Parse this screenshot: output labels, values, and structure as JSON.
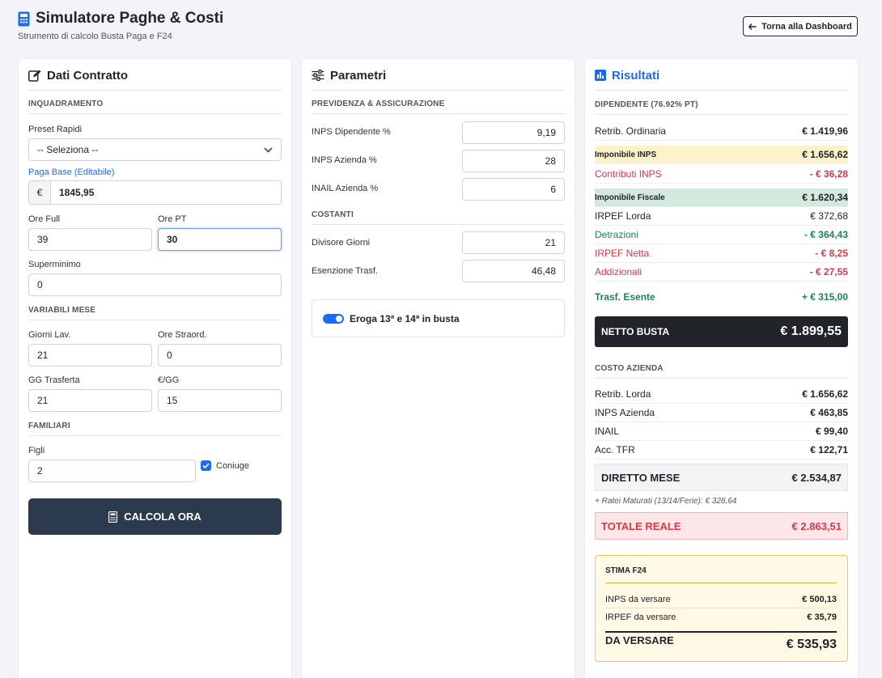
{
  "header": {
    "title": "Simulatore Paghe & Costi",
    "subtitle": "Strumento di calcolo Busta Paga e F24",
    "back_label": "Torna alla Dashboard"
  },
  "contratto": {
    "title": "Dati Contratto",
    "section_inquadramento": "INQUADRAMENTO",
    "preset_label": "Preset Rapidi",
    "preset_value": "-- Seleziona --",
    "paga_base_label": "Paga Base (Editabile)",
    "currency": "€",
    "paga_base_value": "1845,95",
    "ore_full_label": "Ore Full",
    "ore_full_value": "39",
    "ore_pt_label": "Ore PT",
    "ore_pt_value": "30",
    "superminimo_label": "Superminimo",
    "superminimo_value": "0",
    "section_variabili": "VARIABILI MESE",
    "giorni_lav_label": "Giorni Lav.",
    "giorni_lav_value": "21",
    "ore_straord_label": "Ore Straord.",
    "ore_straord_value": "0",
    "gg_trasferta_label": "GG Trasferta",
    "gg_trasferta_value": "21",
    "euro_gg_label": "€/GG",
    "euro_gg_value": "15",
    "section_familiari": "FAMILIARI",
    "figli_label": "Figli",
    "figli_value": "2",
    "coniuge_label": "Coniuge",
    "coniuge_checked": true,
    "calc_button": "CALCOLA ORA"
  },
  "parametri": {
    "title": "Parametri",
    "section_previdenza": "PREVIDENZA & ASSICURAZIONE",
    "inps_dip_label": "INPS Dipendente %",
    "inps_dip_value": "9,19",
    "inps_az_label": "INPS Azienda %",
    "inps_az_value": "28",
    "inail_label": "INAIL Azienda %",
    "inail_value": "6",
    "section_costanti": "COSTANTI",
    "divisore_label": "Divisore Giorni",
    "divisore_value": "21",
    "esenzione_label": "Esenzione Trasf.",
    "esenzione_value": "46,48",
    "toggle_label": "Eroga 13ª e 14ª in busta",
    "toggle_on": true
  },
  "risultati": {
    "title": "Risultati",
    "section_dipendente": "DIPENDENTE (76.92% PT)",
    "rows_dipendente": [
      {
        "k": "Retrib. Ordinaria",
        "v": "€ 1.419,96"
      },
      {
        "k": "Imponibile INPS",
        "v": "€ 1.656,62"
      },
      {
        "k": "Contributi INPS",
        "v": "- € 36,28"
      },
      {
        "k": "Imponibile Fiscale",
        "v": "€ 1.620,34"
      },
      {
        "k": "IRPEF Lorda",
        "v": "€ 372,68"
      },
      {
        "k": "Detrazioni",
        "v": "- € 364,43"
      },
      {
        "k": "IRPEF Netta",
        "v": "- € 8,25"
      },
      {
        "k": "Addizionali",
        "v": "- € 27,55"
      },
      {
        "k": "Trasf. Esente",
        "v": "+ € 315,00"
      }
    ],
    "netto_label": "NETTO BUSTA",
    "netto_value": "€ 1.899,55",
    "section_azienda": "COSTO AZIENDA",
    "rows_azienda": [
      {
        "k": "Retrib. Lorda",
        "v": "€ 1.656,62"
      },
      {
        "k": "INPS Azienda",
        "v": "€ 463,85"
      },
      {
        "k": "INAIL",
        "v": "€ 99,40"
      },
      {
        "k": "Acc. TFR",
        "v": "€ 122,71"
      }
    ],
    "diretto_label": "DIRETTO MESE",
    "diretto_value": "€ 2.534,87",
    "ratei_text": "+ Ratei Maturati (13/14/Ferie): € 328,64",
    "totale_label": "TOTALE REALE",
    "totale_value": "€ 2.863,51",
    "f24": {
      "title": "STIMA F24",
      "inps_label": "INPS da versare",
      "inps_value": "€ 500,13",
      "irpef_label": "IRPEF da versare",
      "irpef_value": "€ 35,79",
      "tot_label": "DA VERSARE",
      "tot_value": "€ 535,93"
    }
  },
  "colors": {
    "accent": "#1d6bf0",
    "dark": "#2b3a4d",
    "negative": "#d33a4a",
    "positive": "#198754"
  }
}
